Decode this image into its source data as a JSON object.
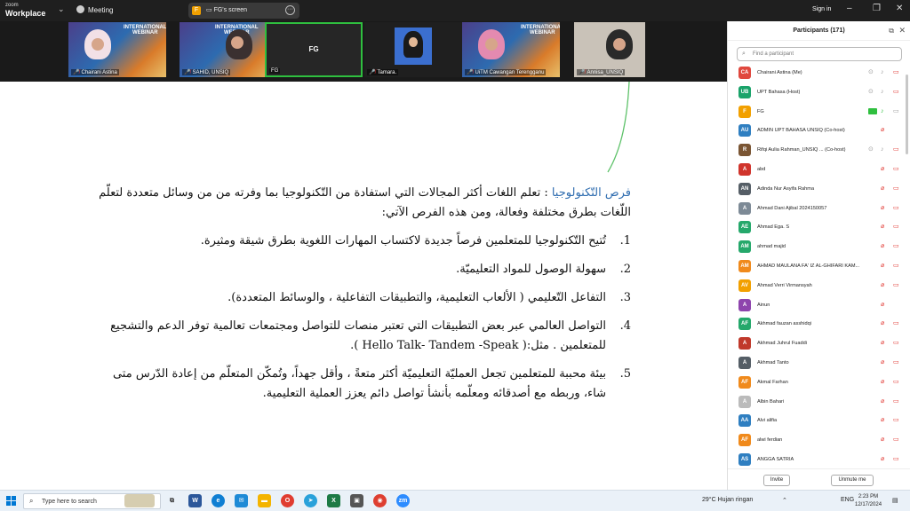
{
  "app": {
    "logo_line1": "zoom",
    "logo_line2": "Workplace",
    "meeting_label": "Meeting",
    "share_badge": "F",
    "share_title": "FG's screen",
    "sign_in": "Sign in"
  },
  "gallery": [
    {
      "name": "Chairani Astina",
      "poster_title": "INTERNATIONAL\nWEBINAR"
    },
    {
      "name": "SAHID, UNSIQ",
      "poster_title": "INTERNATIONAL\nWEBINAR"
    },
    {
      "name": "FG",
      "initials": "FG"
    },
    {
      "name": "Tamara."
    },
    {
      "name": "UiTM Cawangan Terengganu",
      "poster_title": "INTERNATIONAL\nWEBINAR"
    },
    {
      "name": "Annisa_UNSIQ"
    }
  ],
  "slide": {
    "intro_highlight": "فرص التّكنولوجيا",
    "intro_text": " : تعلم اللغات أكثر المجالات التي استفادة من التّكنولوجيا  بما وفرته من من وسائل متعددة لتعلّم اللّغات بطرق مختلفة وفعالة، ومن هذه الفرص الآتي:",
    "items": [
      {
        "num": ".1",
        "text": "تُتيح التّكنولوجيا  للمتعلمين فرصاً جديدة لاكتساب المهارات اللغوية بطرق شيقة ومثيرة."
      },
      {
        "num": ".2",
        "text": "سهولة الوصول للمواد التعليميّة."
      },
      {
        "num": ".3",
        "text": "التفاعل التّعليمي ( الألعاب التعليمية، والتطبيقات التفاعلية ، والوسائط المتعددة)."
      },
      {
        "num": ".4",
        "text": "التواصل العالمي عبر بعض التطبيقات التي تعتبر منصات للتواصل ومجتمعات تعالمية توفر الدعم والتشجيع للمتعلمين . مثل:( Hello Talk- Tandem -Speak )."
      },
      {
        "num": ".5",
        "text": "بيئة محببة للمتعلمين تجعل العمليّة التعليميّة أكثر متعةً ، وأقل جهداً، وتُمكّن المتعلّم من إعادة الدّرس متى شاء، وربطه مع أصدقائه ومعلّمه بأنشأ تواصل دائم يعزز العملية التعليمية."
      }
    ]
  },
  "participants": {
    "title": "Participants (171)",
    "search_placeholder": "Find a participant",
    "invite": "Invite",
    "unmute_me": "Unmute me",
    "list": [
      {
        "initials": "CA",
        "name": "Chairani Astina (Me)",
        "color": "#e0483e",
        "mic": "on",
        "video": "off"
      },
      {
        "initials": "UB",
        "name": "UPT Bahasa (Host)",
        "color": "#1aa36a",
        "mic": "on",
        "video": "off"
      },
      {
        "initials": "F",
        "name": "FG",
        "color": "#f2a000",
        "mic": "green",
        "video": "green"
      },
      {
        "initials": "AU",
        "name": "ADMIN UPT BAHASA UNSIQ (Co-host)",
        "color": "#2f7fc1",
        "mic": "off",
        "video": "none"
      },
      {
        "initials": "R",
        "name": "Rifqi Aulia Rahman_UNSIQ ... (Co-host)",
        "color": "#7a5533",
        "mic": "on",
        "video": "off"
      },
      {
        "initials": "A",
        "name": "abd",
        "color": "#d0342c",
        "mic": "off",
        "video": "off"
      },
      {
        "initials": "AN",
        "name": "Adinda Nur Asyifa Rahma",
        "color": "#555e66",
        "mic": "off",
        "video": "off"
      },
      {
        "initials": "A",
        "name": "Ahmad Dani Ajibal 2024150057",
        "color": "#7d8a96",
        "mic": "off",
        "video": "off"
      },
      {
        "initials": "AE",
        "name": "Ahmad Ega. S",
        "color": "#25a86b",
        "mic": "off",
        "video": "off"
      },
      {
        "initials": "AM",
        "name": "ahmad majid",
        "color": "#25a86b",
        "mic": "off",
        "video": "off"
      },
      {
        "initials": "AM",
        "name": "AHMAD MAULANA FA' IZ AL-GHIFARI KAM...",
        "color": "#f08a1c",
        "mic": "off",
        "video": "off"
      },
      {
        "initials": "AV",
        "name": "Ahmad Verri Virmansyah",
        "color": "#f2a000",
        "mic": "off",
        "video": "off"
      },
      {
        "initials": "A",
        "name": "Ainun",
        "color": "#8e44ad",
        "mic": "off",
        "video": "none"
      },
      {
        "initials": "AF",
        "name": "Akhmad fauzan asshidqi",
        "color": "#25a86b",
        "mic": "off",
        "video": "off"
      },
      {
        "initials": "A",
        "name": "Akhmad Juhrul Fuaddi",
        "color": "#c0392b",
        "mic": "off",
        "video": "off"
      },
      {
        "initials": "A",
        "name": "Akhmad Tanto",
        "color": "#555e66",
        "mic": "off",
        "video": "off"
      },
      {
        "initials": "AF",
        "name": "Akmal Farhan",
        "color": "#f08a1c",
        "mic": "off",
        "video": "off"
      },
      {
        "initials": "A",
        "name": "Albin Bahari",
        "color": "#bbbbbb",
        "mic": "off",
        "video": "off"
      },
      {
        "initials": "AA",
        "name": "Alvi alifia",
        "color": "#2f7fc1",
        "mic": "off",
        "video": "off"
      },
      {
        "initials": "AF",
        "name": "alwi ferdian",
        "color": "#f08a1c",
        "mic": "off",
        "video": "off"
      },
      {
        "initials": "AS",
        "name": "ANGGA SATRIA",
        "color": "#2f7fc1",
        "mic": "off",
        "video": "off"
      }
    ]
  },
  "taskbar": {
    "search_placeholder": "Type here to search",
    "weather": "29°C  Hujan ringan",
    "lang": "ENG",
    "time": "2:23 PM",
    "date": "12/17/2024"
  }
}
